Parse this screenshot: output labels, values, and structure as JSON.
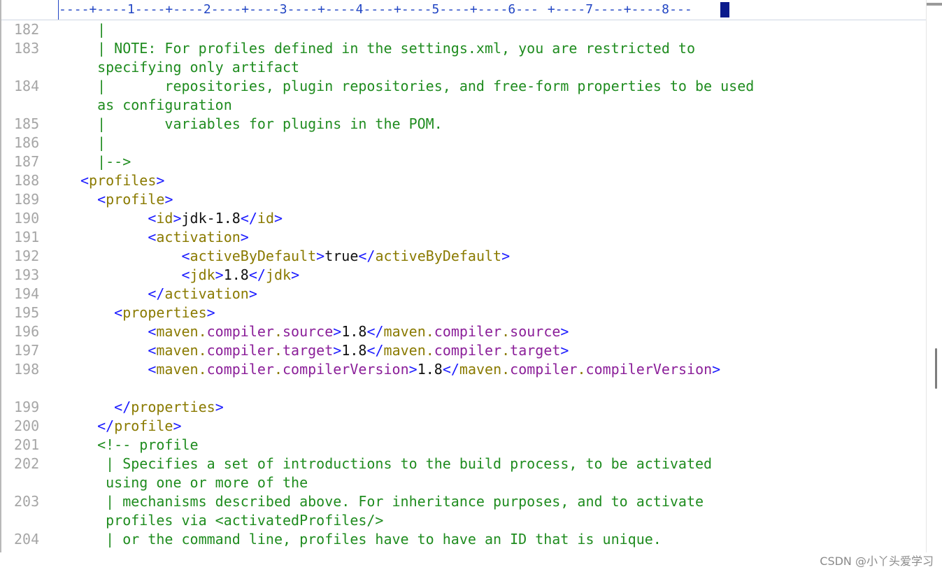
{
  "ruler": {
    "text": "----+----1----+----2----+----3----+----4----+----5----+----6---",
    "text2": "+----7----+----8---"
  },
  "watermark": "CSDN @小丫头爱学习",
  "lines": [
    {
      "n": "182",
      "text": "  |"
    },
    {
      "n": "183",
      "text": "  | NOTE: For profiles defined in the settings.xml, you are restricted to"
    },
    {
      "n": "",
      "text": "  specifying only artifact"
    },
    {
      "n": "184",
      "text": "  |       repositories, plugin repositories, and free-form properties to be used"
    },
    {
      "n": "",
      "text": "  as configuration"
    },
    {
      "n": "185",
      "text": "  |       variables for plugins in the POM."
    },
    {
      "n": "186",
      "text": "  |"
    },
    {
      "n": "187",
      "text": "  |-->"
    },
    {
      "n": "188",
      "text": "<profiles>"
    },
    {
      "n": "189",
      "text": "  <profile>"
    },
    {
      "n": "190",
      "text": "        <id>jdk-1.8</id>"
    },
    {
      "n": "191",
      "text": "        <activation>"
    },
    {
      "n": "192",
      "text": "            <activeByDefault>true</activeByDefault>"
    },
    {
      "n": "193",
      "text": "            <jdk>1.8</jdk>"
    },
    {
      "n": "194",
      "text": "        </activation>"
    },
    {
      "n": "195",
      "text": "    <properties>"
    },
    {
      "n": "196",
      "text": "        <maven.compiler.source>1.8</maven.compiler.source>"
    },
    {
      "n": "197",
      "text": "        <maven.compiler.target>1.8</maven.compiler.target>"
    },
    {
      "n": "198",
      "text": "        <maven.compiler.compilerVersion>1.8</maven.compiler.compilerVersion>"
    },
    {
      "n": "",
      "text": ""
    },
    {
      "n": "199",
      "text": "    </properties>"
    },
    {
      "n": "200",
      "text": "  </profile>"
    },
    {
      "n": "201",
      "text": "  <!-- profile"
    },
    {
      "n": "202",
      "text": "   | Specifies a set of introductions to the build process, to be activated"
    },
    {
      "n": "",
      "text": "   using one or more of the"
    },
    {
      "n": "203",
      "text": "   | mechanisms described above. For inheritance purposes, and to activate"
    },
    {
      "n": "",
      "text": "   profiles via <activatedProfiles/>"
    },
    {
      "n": "204",
      "text": "   | or the command line, profiles have to have an ID that is unique."
    }
  ]
}
